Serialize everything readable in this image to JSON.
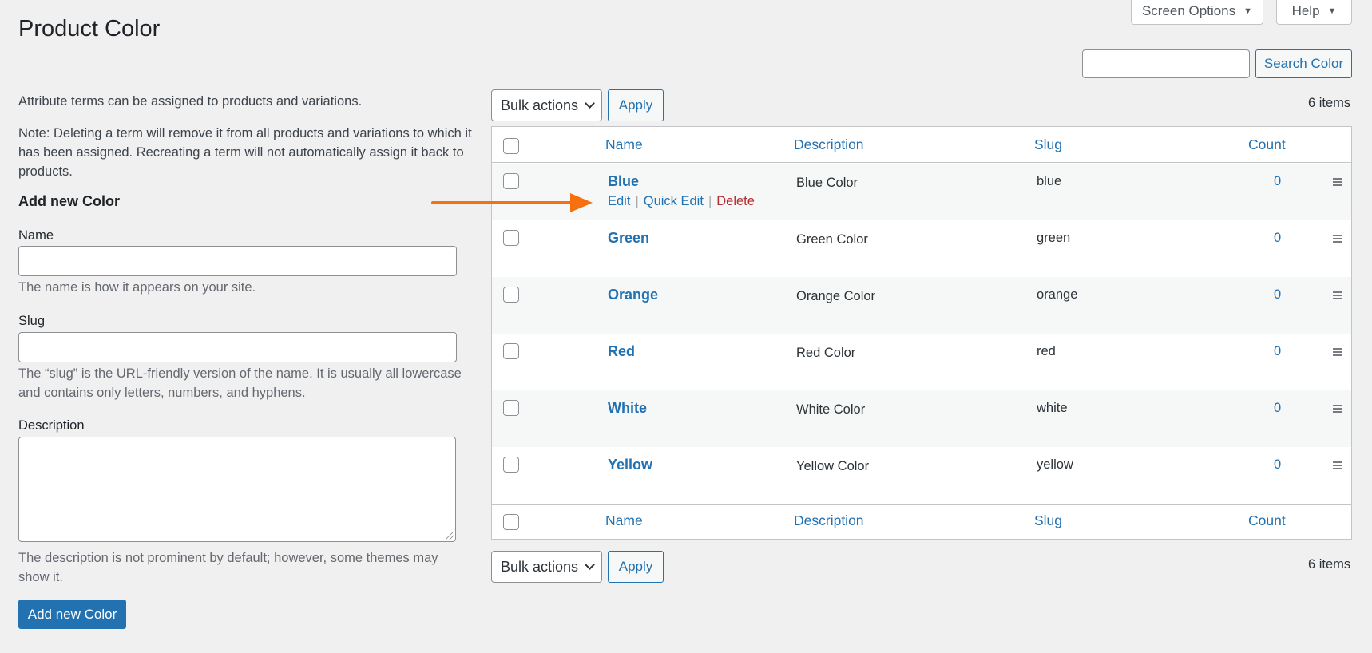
{
  "screen_tabs": {
    "screen_options": "Screen Options",
    "help": "Help"
  },
  "page_title": "Product Color",
  "search": {
    "value": "",
    "button": "Search Color"
  },
  "intro": {
    "line1": "Attribute terms can be assigned to products and variations.",
    "note": "Note: Deleting a term will remove it from all products and variations to which it has been assigned. Recreating a term will not automatically assign it back to products."
  },
  "form": {
    "heading": "Add new Color",
    "name_label": "Name",
    "name_value": "",
    "name_help": "The name is how it appears on your site.",
    "slug_label": "Slug",
    "slug_value": "",
    "slug_help": "The “slug” is the URL-friendly version of the name. It is usually all lowercase and contains only letters, numbers, and hyphens.",
    "description_label": "Description",
    "description_value": "",
    "description_help": "The description is not prominent by default; however, some themes may show it.",
    "submit": "Add new Color"
  },
  "bulk": {
    "select_value": "Bulk actions",
    "apply": "Apply",
    "items": "6 items"
  },
  "table": {
    "columns": {
      "name": "Name",
      "description": "Description",
      "slug": "Slug",
      "count": "Count"
    },
    "row_actions": {
      "edit": "Edit",
      "quick_edit": "Quick Edit",
      "delete": "Delete",
      "separator": "|"
    },
    "rows": [
      {
        "name": "Blue",
        "description": "Blue Color",
        "slug": "blue",
        "count": "0"
      },
      {
        "name": "Green",
        "description": "Green Color",
        "slug": "green",
        "count": "0"
      },
      {
        "name": "Orange",
        "description": "Orange Color",
        "slug": "orange",
        "count": "0"
      },
      {
        "name": "Red",
        "description": "Red Color",
        "slug": "red",
        "count": "0"
      },
      {
        "name": "White",
        "description": "White Color",
        "slug": "white",
        "count": "0"
      },
      {
        "name": "Yellow",
        "description": "Yellow Color",
        "slug": "yellow",
        "count": "0"
      }
    ]
  },
  "colors": {
    "link": "#2271b1",
    "primary_button": "#2271b1",
    "delete": "#b32d2e",
    "annotation_arrow": "#f6700f",
    "background": "#f0f0f1"
  },
  "icons": {
    "dropdown": "caret-down-icon",
    "drag_handle": "drag-handle-icon",
    "annotation": "arrow-right-icon"
  }
}
